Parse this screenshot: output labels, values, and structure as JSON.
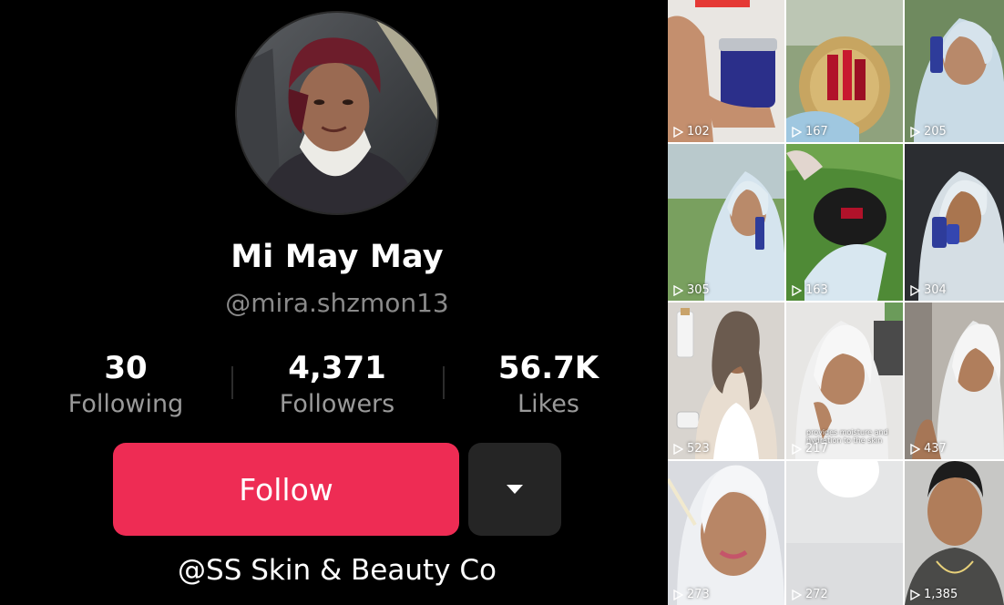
{
  "profile": {
    "name": "Mi May May",
    "handle": "@mira.shzmon13",
    "stats": [
      {
        "value": "30",
        "label": "Following"
      },
      {
        "value": "4,371",
        "label": "Followers"
      },
      {
        "value": "56.7K",
        "label": "Likes"
      }
    ],
    "follow_label": "Follow",
    "bio_link": "@SS Skin & Beauty Co"
  },
  "grid": {
    "tiles": [
      {
        "views": "102"
      },
      {
        "views": "167"
      },
      {
        "views": "205"
      },
      {
        "views": "305"
      },
      {
        "views": "163"
      },
      {
        "views": "304"
      },
      {
        "views": "523"
      },
      {
        "views": "217",
        "caption": "provides moisture and hydration to the skin"
      },
      {
        "views": "437"
      },
      {
        "views": "273"
      },
      {
        "views": "272"
      },
      {
        "views": "1,385"
      }
    ]
  },
  "colors": {
    "follow_button": "#ee2c54",
    "more_button": "#252525",
    "secondary_text": "#8a8a8a"
  },
  "icons": {
    "more": "caret-down-icon",
    "views": "play-icon"
  }
}
